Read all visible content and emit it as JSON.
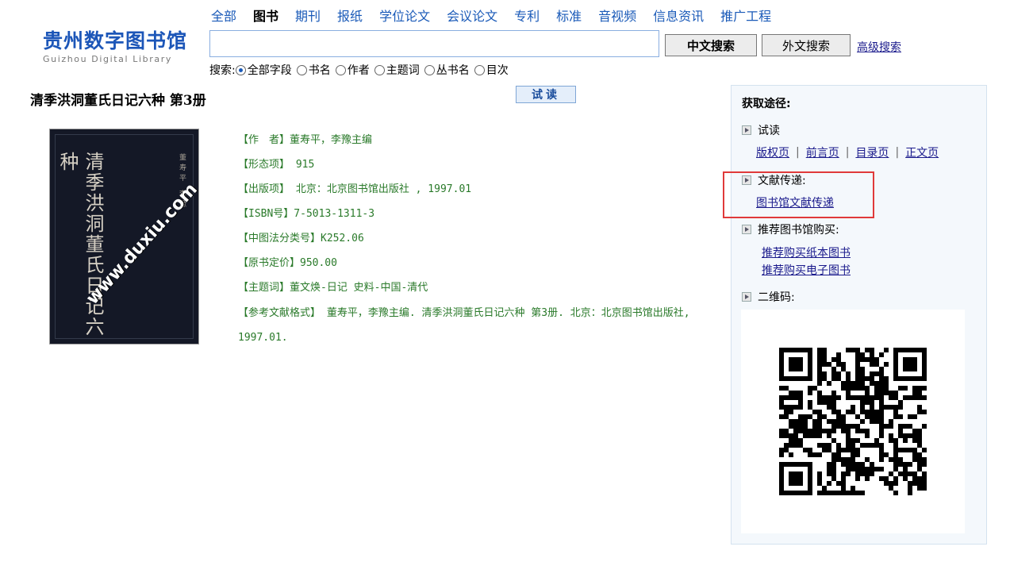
{
  "logo": {
    "cn": "贵州数字图书馆",
    "en": "Guizhou Digital Library"
  },
  "nav": [
    {
      "label": "全部",
      "active": false
    },
    {
      "label": "图书",
      "active": true
    },
    {
      "label": "期刊",
      "active": false
    },
    {
      "label": "报纸",
      "active": false
    },
    {
      "label": "学位论文",
      "active": false
    },
    {
      "label": "会议论文",
      "active": false
    },
    {
      "label": "专利",
      "active": false
    },
    {
      "label": "标准",
      "active": false
    },
    {
      "label": "音视频",
      "active": false
    },
    {
      "label": "信息资讯",
      "active": false
    },
    {
      "label": "推广工程",
      "active": false
    }
  ],
  "search": {
    "value": "",
    "btn_cn": "中文搜索",
    "btn_en": "外文搜索",
    "advanced": "高级搜索",
    "label": "搜索:",
    "options": [
      {
        "label": "全部字段",
        "checked": true
      },
      {
        "label": "书名",
        "checked": false
      },
      {
        "label": "作者",
        "checked": false
      },
      {
        "label": "主题词",
        "checked": false
      },
      {
        "label": "丛书名",
        "checked": false
      },
      {
        "label": "目次",
        "checked": false
      }
    ]
  },
  "book": {
    "title": "清季洪洞董氏日记六种 第3册",
    "trial_btn": "试读",
    "cover": {
      "title": "清季洪洞董氏日记六种",
      "author": "董寿平 李豫",
      "watermark": "www.duxiu.com"
    },
    "meta": [
      "【作　者】董寿平，李豫主编",
      "【形态项】 915",
      "【出版项】 北京：北京图书馆出版社 , 1997.01",
      "【ISBN号】7-5013-1311-3",
      "【中图法分类号】K252.06",
      "【原书定价】950.00",
      "【主题词】董文焕-日记 史料-中国-清代",
      "【参考文献格式】 董寿平，李豫主编. 清季洪洞董氏日记六种 第3册. 北京：北京图书馆出版社, 1997.01."
    ]
  },
  "panel": {
    "title": "获取途径:",
    "sec_trial": "试读",
    "trial_links": [
      "版权页",
      "前言页",
      "目录页",
      "正文页"
    ],
    "sec_delivery": "文献传递:",
    "delivery_link": "图书馆文献传递",
    "sec_buy": "推荐图书馆购买:",
    "buy_links": [
      "推荐购买纸本图书",
      "推荐购买电子图书"
    ],
    "sec_qr": "二维码:"
  }
}
